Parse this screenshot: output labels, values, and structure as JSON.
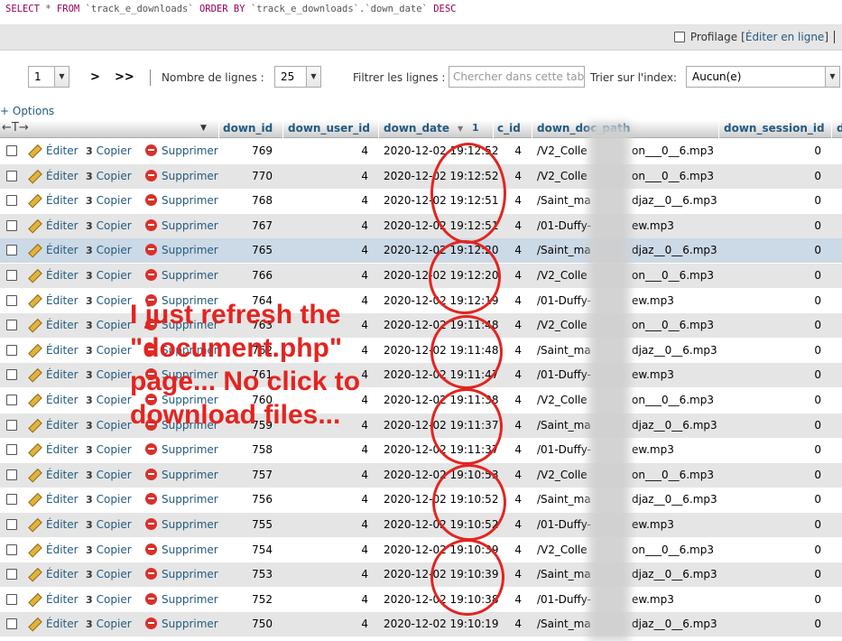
{
  "sql": {
    "kw_select": "SELECT",
    "star": "*",
    "kw_from": "FROM",
    "table": "`track_e_downloads`",
    "kw_order": "ORDER BY",
    "column": "`track_e_downloads`.`down_date`",
    "kw_desc": "DESC"
  },
  "profile": {
    "label": "Profilage",
    "edit_link": "Éditer en ligne"
  },
  "nav": {
    "page_value": "1",
    "next": ">",
    "last": ">>",
    "rows_label": "Nombre de lignes :",
    "rows_value": "25",
    "filter_label": "Filtrer les lignes :",
    "filter_placeholder": "Chercher dans cette tabl",
    "sort_label": "Trier sur l'index:",
    "sort_value": "Aucun(e)"
  },
  "options": "+ Options",
  "columns": {
    "down_id": "down_id",
    "down_user_id": "down_user_id",
    "down_date": "down_date",
    "sort_marker": "1",
    "c_id": "c_id",
    "down_doc_path": "down_doc_path",
    "down_session_id": "down_session_id",
    "more": "d"
  },
  "actions": {
    "edit": "Éditer",
    "copy": "Copier",
    "delete": "Supprimer"
  },
  "rows": [
    {
      "id": "769",
      "user": "4",
      "date": "2020-12-02 19:12:52",
      "c": "4",
      "path_a": "/V2_Colle",
      "path_b": "on___0__6.mp3",
      "session": "0"
    },
    {
      "id": "770",
      "user": "4",
      "date": "2020-12-02 19:12:52",
      "c": "4",
      "path_a": "/V2_Colle",
      "path_b": "on___0__6.mp3",
      "session": "0"
    },
    {
      "id": "768",
      "user": "4",
      "date": "2020-12-02 19:12:51",
      "c": "4",
      "path_a": "/Saint_ma",
      "path_b": "djaz__0__6.mp3",
      "session": "0"
    },
    {
      "id": "767",
      "user": "4",
      "date": "2020-12-02 19:12:51",
      "c": "4",
      "path_a": "/01-Duffy-",
      "path_b": "ew.mp3",
      "session": "0"
    },
    {
      "id": "765",
      "user": "4",
      "date": "2020-12-02 19:12:20",
      "c": "4",
      "path_a": "/Saint_ma",
      "path_b": "djaz__0__6.mp3",
      "session": "0"
    },
    {
      "id": "766",
      "user": "4",
      "date": "2020-12-02 19:12:20",
      "c": "4",
      "path_a": "/V2_Colle",
      "path_b": "on___0__6.mp3",
      "session": "0"
    },
    {
      "id": "764",
      "user": "4",
      "date": "2020-12-02 19:12:19",
      "c": "4",
      "path_a": "/01-Duffy-",
      "path_b": "ew.mp3",
      "session": "0"
    },
    {
      "id": "763",
      "user": "4",
      "date": "2020-12-02 19:11:48",
      "c": "4",
      "path_a": "/V2_Colle",
      "path_b": "on___0__6.mp3",
      "session": "0"
    },
    {
      "id": "762",
      "user": "4",
      "date": "2020-12-02 19:11:48",
      "c": "4",
      "path_a": "/Saint_ma",
      "path_b": "djaz__0__6.mp3",
      "session": "0"
    },
    {
      "id": "761",
      "user": "4",
      "date": "2020-12-02 19:11:47",
      "c": "4",
      "path_a": "/01-Duffy-",
      "path_b": "ew.mp3",
      "session": "0"
    },
    {
      "id": "760",
      "user": "4",
      "date": "2020-12-02 19:11:38",
      "c": "4",
      "path_a": "/V2_Colle",
      "path_b": "on___0__6.mp3",
      "session": "0"
    },
    {
      "id": "759",
      "user": "4",
      "date": "2020-12-02 19:11:37",
      "c": "4",
      "path_a": "/Saint_ma",
      "path_b": "djaz__0__6.mp3",
      "session": "0"
    },
    {
      "id": "758",
      "user": "4",
      "date": "2020-12-02 19:11:37",
      "c": "4",
      "path_a": "/01-Duffy-",
      "path_b": "ew.mp3",
      "session": "0"
    },
    {
      "id": "757",
      "user": "4",
      "date": "2020-12-02 19:10:53",
      "c": "4",
      "path_a": "/V2_Colle",
      "path_b": "on___0__6.mp3",
      "session": "0"
    },
    {
      "id": "756",
      "user": "4",
      "date": "2020-12-02 19:10:52",
      "c": "4",
      "path_a": "/Saint_ma",
      "path_b": "djaz__0__6.mp3",
      "session": "0"
    },
    {
      "id": "755",
      "user": "4",
      "date": "2020-12-02 19:10:52",
      "c": "4",
      "path_a": "/01-Duffy-",
      "path_b": "ew.mp3",
      "session": "0"
    },
    {
      "id": "754",
      "user": "4",
      "date": "2020-12-02 19:10:39",
      "c": "4",
      "path_a": "/V2_Colle",
      "path_b": "on___0__6.mp3",
      "session": "0"
    },
    {
      "id": "753",
      "user": "4",
      "date": "2020-12-02 19:10:39",
      "c": "4",
      "path_a": "/Saint_ma",
      "path_b": "djaz__0__6.mp3",
      "session": "0"
    },
    {
      "id": "752",
      "user": "4",
      "date": "2020-12-02 19:10:38",
      "c": "4",
      "path_a": "/01-Duffy-",
      "path_b": "ew.mp3",
      "session": "0"
    },
    {
      "id": "750",
      "user": "4",
      "date": "2020-12-02 19:10:19",
      "c": "4",
      "path_a": "/Saint_ma",
      "path_b": "djaz__0__6.mp3",
      "session": "0"
    }
  ],
  "annotation": {
    "line1": "I just refresh the",
    "line2": "\"document.php\"",
    "line3": "page... No click to",
    "line4": "download files...",
    "color": "#e32420"
  }
}
